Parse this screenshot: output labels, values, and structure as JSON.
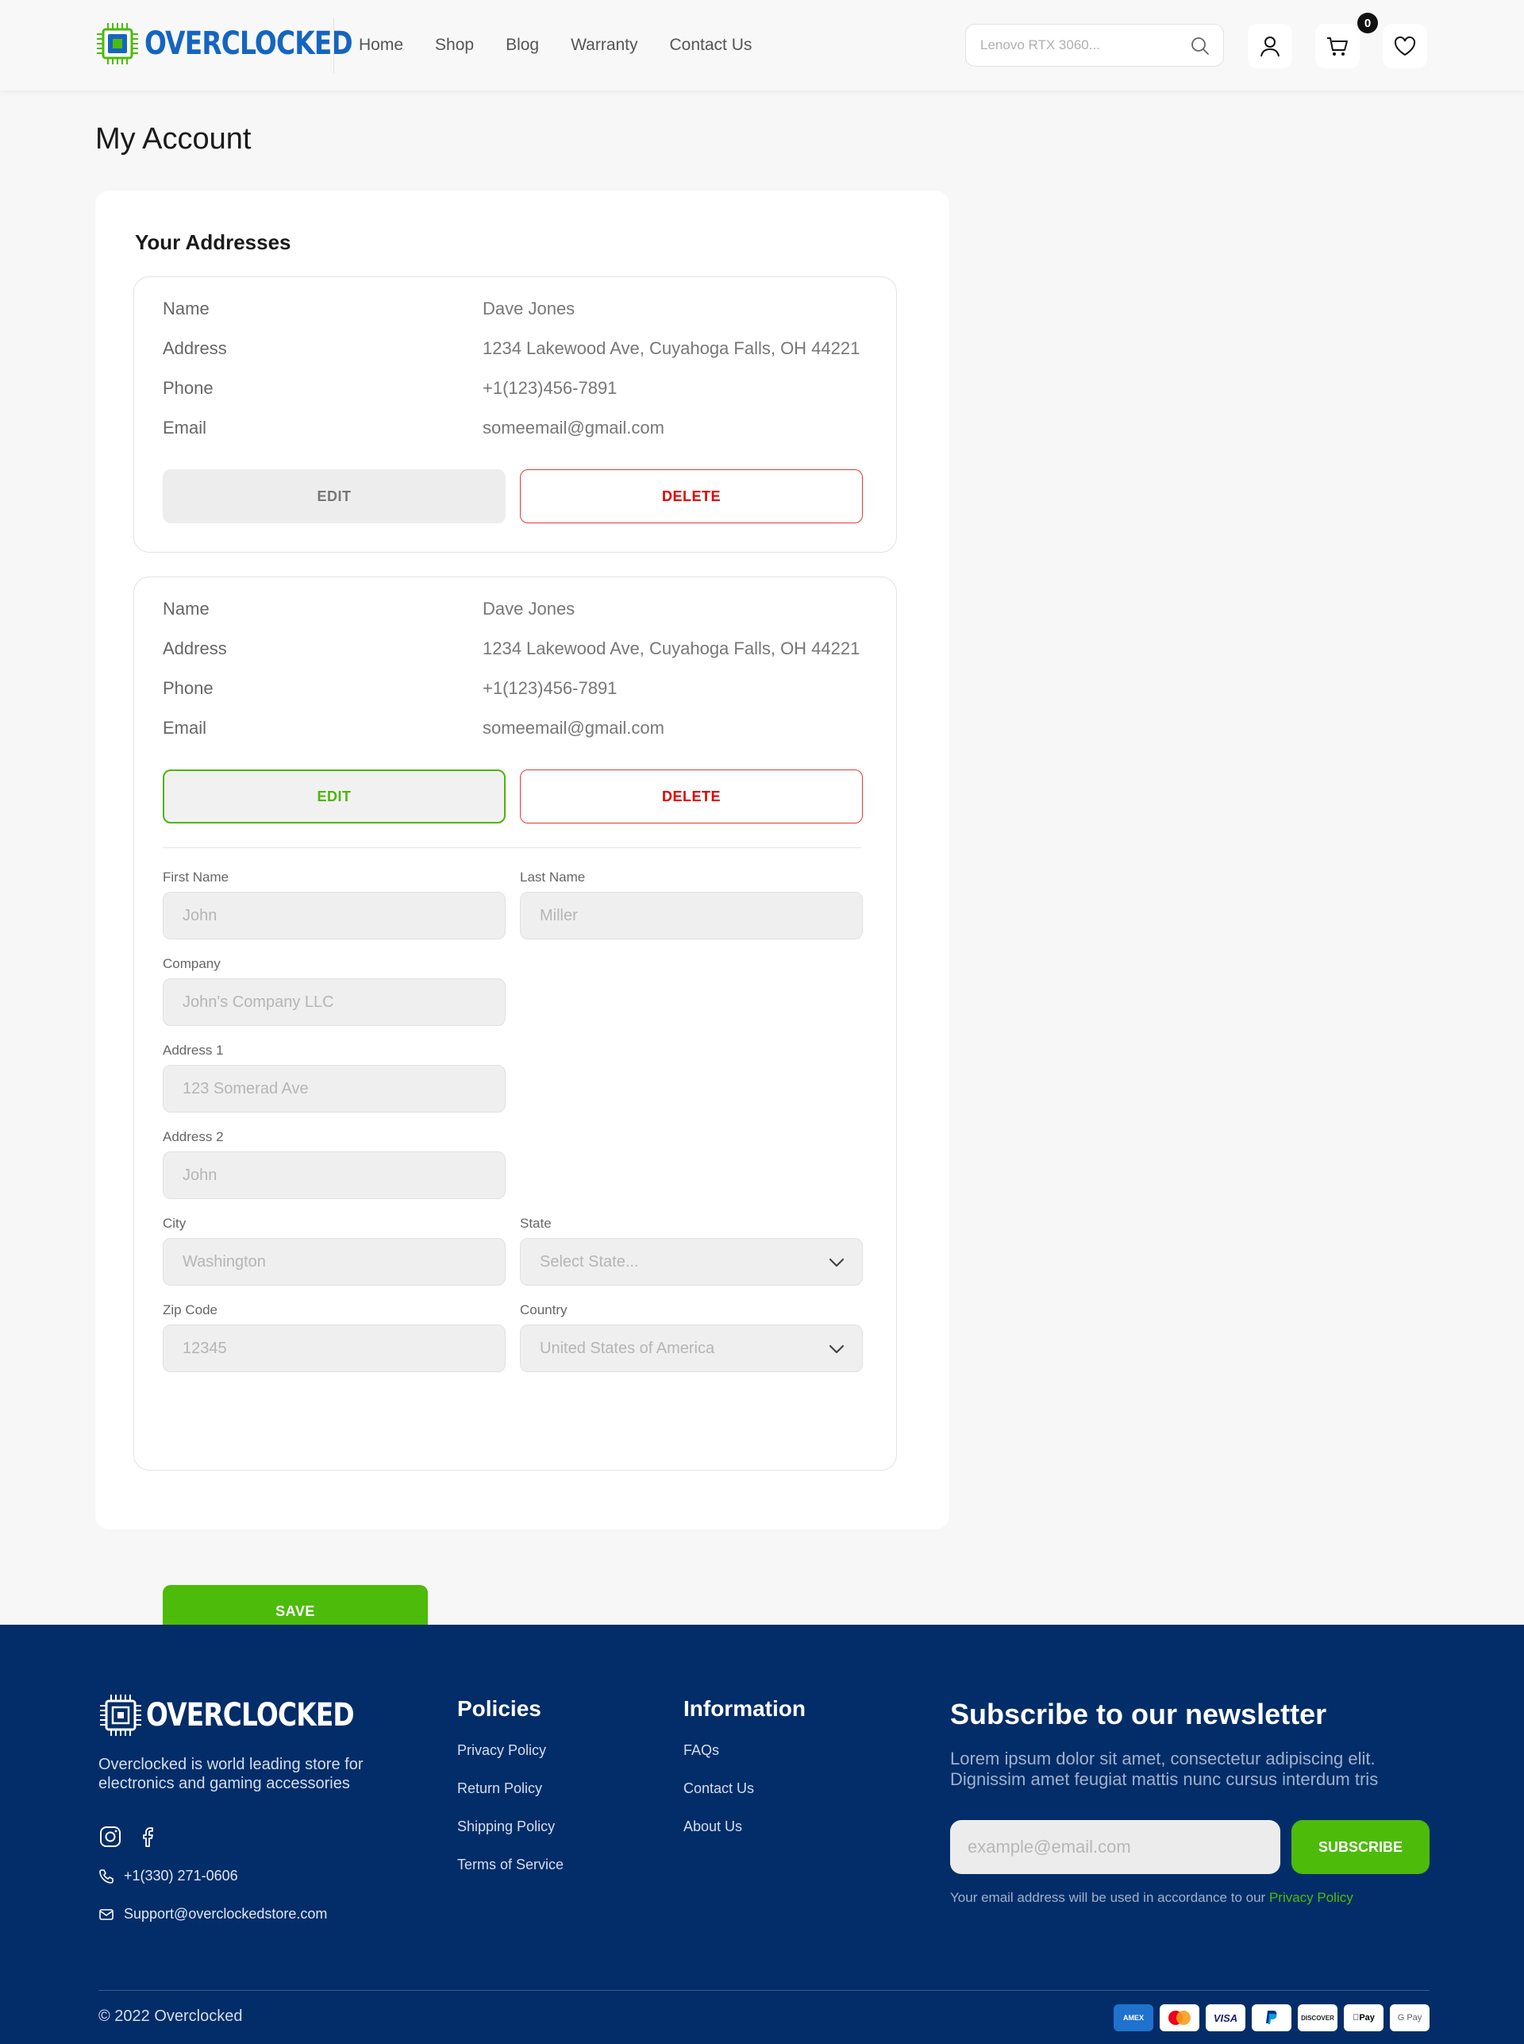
{
  "header": {
    "brand": "OVERCLOCKED",
    "nav": [
      "Home",
      "Shop",
      "Blog",
      "Warranty",
      "Contact Us"
    ],
    "search_placeholder": "Lenovo RTX 3060...",
    "cart_count": "0"
  },
  "main": {
    "title": "My Account",
    "section_title": "Your Addresses",
    "row_labels": [
      "Name",
      "Address",
      "Phone",
      "Email"
    ],
    "addresses": [
      {
        "name": "Dave Jones",
        "address": "1234 Lakewood Ave, Cuyahoga Falls, OH 44221",
        "phone": "+1(123)456-7891",
        "email": "someemail@gmail.com"
      },
      {
        "name": "Dave Jones",
        "address": "1234 Lakewood Ave, Cuyahoga Falls, OH 44221",
        "phone": "+1(123)456-7891",
        "email": "someemail@gmail.com"
      }
    ],
    "edit_label": "EDIT",
    "delete_label": "DELETE",
    "form": {
      "first_name": {
        "label": "First Name",
        "placeholder": "John"
      },
      "last_name": {
        "label": "Last Name",
        "placeholder": "Miller"
      },
      "company": {
        "label": "Company",
        "placeholder": "John's Company LLC"
      },
      "address1": {
        "label": "Address 1",
        "placeholder": "123 Somerad Ave"
      },
      "address2": {
        "label": "Address 2",
        "placeholder": "John"
      },
      "city": {
        "label": "City",
        "placeholder": "Washington"
      },
      "state": {
        "label": "State",
        "value": "Select State..."
      },
      "zip": {
        "label": "Zip Code",
        "placeholder": "12345"
      },
      "country": {
        "label": "Country",
        "value": "United States of America"
      },
      "save_label": "SAVE"
    }
  },
  "footer": {
    "brand": "OVERCLOCKED",
    "description": "Overclocked is world leading store for electronics and gaming accessories",
    "phone": "+1(330) 271-0606",
    "email": "Support@overclockedstore.com",
    "policies_title": "Policies",
    "policies": [
      "Privacy Policy",
      "Return Policy",
      "Shipping Policy",
      "Terms of Service"
    ],
    "info_title": "Information",
    "info": [
      "FAQs",
      "Contact Us",
      "About Us"
    ],
    "newsletter_title": "Subscribe to our newsletter",
    "newsletter_desc": "Lorem ipsum dolor sit amet, consectetur adipiscing elit. Dignissim amet feugiat mattis nunc cursus interdum tris",
    "email_placeholder": "example@email.com",
    "subscribe_label": "SUBSCRIBE",
    "note_text": "Your email address will be used in accordance to our ",
    "note_link": "Privacy Policy",
    "copyright": "© 2022 Overclocked",
    "payments": [
      "AMEX",
      "Mastercard",
      "VISA",
      "PayPal",
      "DISCOVER",
      "Apple Pay",
      "G Pay"
    ]
  },
  "colors": {
    "accent": "#4cbb0a",
    "brand_blue": "#1565c0",
    "footer_bg": "#032d69",
    "danger": "#e53935"
  }
}
